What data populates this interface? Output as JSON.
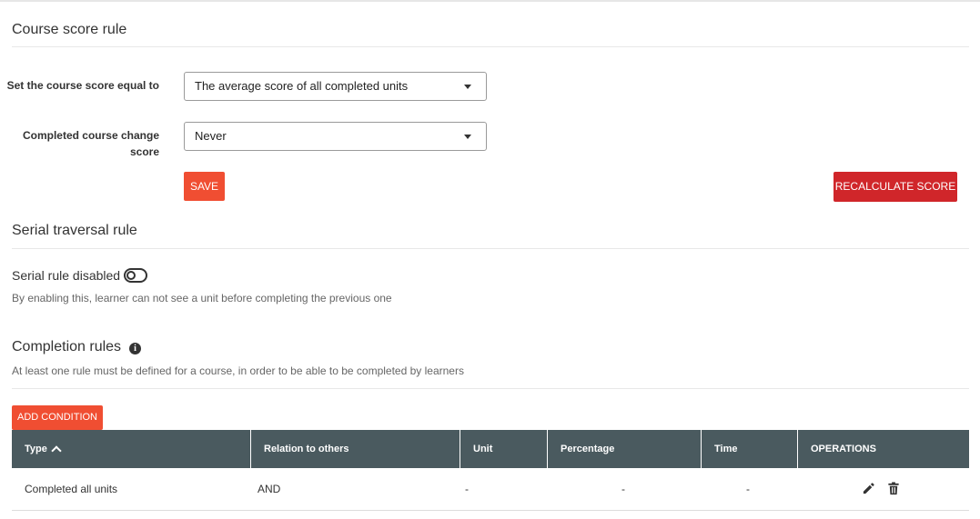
{
  "course_score": {
    "title": "Course score rule",
    "score_equal_label": "Set the course score equal to",
    "score_equal_value": "The average score of all completed units",
    "change_score_label": "Completed course change score",
    "change_score_value": "Never",
    "save_label": "SAVE",
    "recalculate_label": "RECALCULATE SCORE"
  },
  "serial": {
    "title": "Serial traversal rule",
    "toggle_label": "Serial rule disabled",
    "toggle_on": false,
    "description": "By enabling this, learner can not see a unit before completing the previous one"
  },
  "completion": {
    "title": "Completion rules",
    "info_icon": "info-icon",
    "description": "At least one rule must be defined for a course, in order to be able to be completed by learners",
    "add_label": "ADD CONDITION",
    "columns": [
      "Type",
      "Relation to others",
      "Unit",
      "Percentage",
      "Time",
      "OPERATIONS"
    ],
    "rows": [
      {
        "type": "Completed all units",
        "relation": "AND",
        "unit": "-",
        "percentage": "-",
        "time": "-"
      }
    ],
    "operation_icons": [
      "pencil-icon",
      "trash-icon"
    ]
  },
  "colors": {
    "accent_orange": "#f04e32",
    "accent_red": "#d0262a",
    "table_header": "#4a5a5f"
  }
}
